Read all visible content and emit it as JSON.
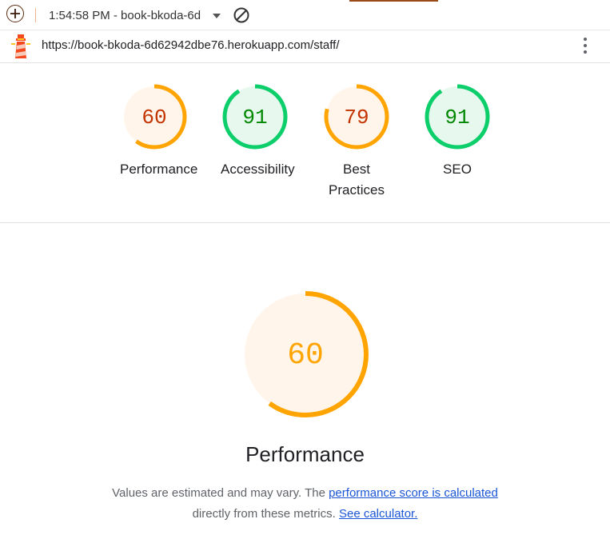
{
  "toolbar": {
    "report_title": "1:54:58 PM - book-bkoda-6d",
    "new_report_icon": "plus-circle-icon",
    "clear_icon": "block-icon"
  },
  "urlbar": {
    "url": "https://book-bkoda-6d62942dbe76.herokuapp.com/staff/",
    "logo_icon": "lighthouse-icon",
    "menu_icon": "more-vert-icon"
  },
  "colors": {
    "average": "#ffa400",
    "average_text": "#c33300",
    "average_bg": "#fff5ea",
    "pass": "#0cce6b",
    "pass_text": "#008800",
    "pass_bg": "#e7f8ee"
  },
  "gauges": [
    {
      "score": "60",
      "value": 0.6,
      "label": "Performance",
      "rating": "average"
    },
    {
      "score": "91",
      "value": 0.91,
      "label": "Accessibility",
      "rating": "pass"
    },
    {
      "score": "79",
      "value": 0.79,
      "label": "Best Practices",
      "rating": "average"
    },
    {
      "score": "91",
      "value": 0.91,
      "label": "SEO",
      "rating": "pass"
    }
  ],
  "performance": {
    "score": "60",
    "value": 0.6,
    "title": "Performance",
    "desc_prefix": "Values are estimated and may vary. The ",
    "desc_link1": "performance score is calculated",
    "desc_middle": "directly from these metrics. ",
    "desc_link2": "See calculator."
  }
}
